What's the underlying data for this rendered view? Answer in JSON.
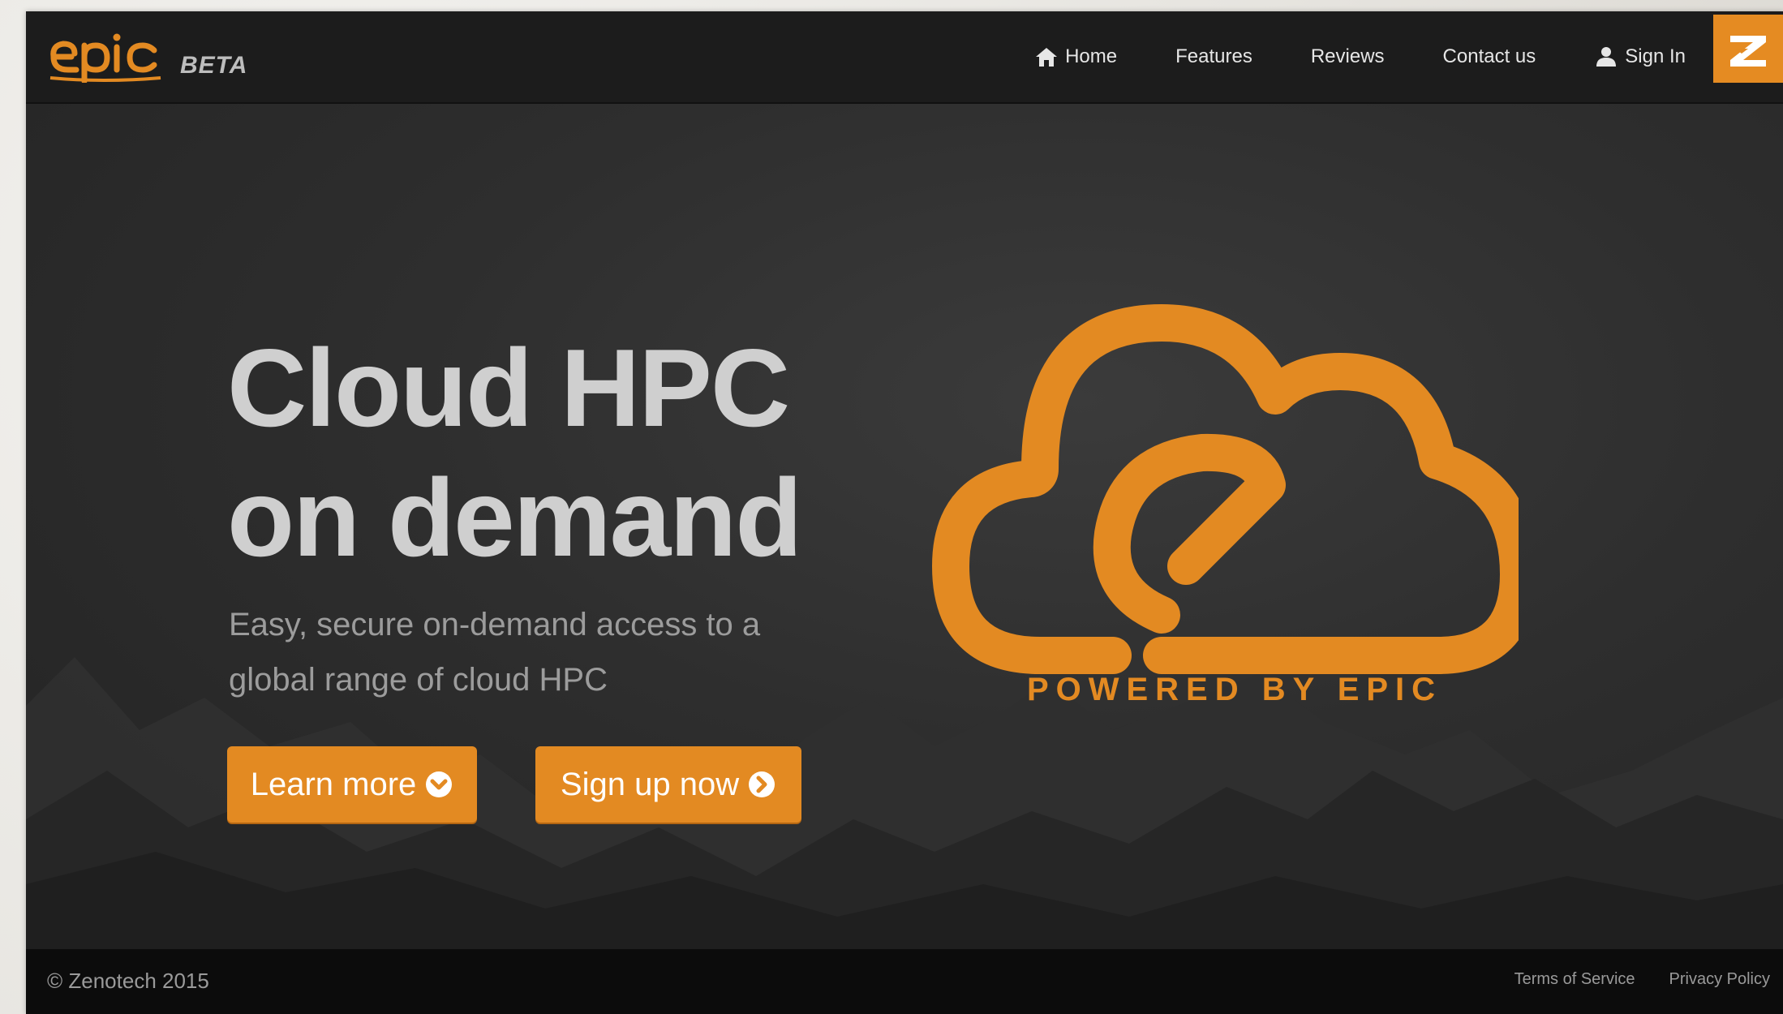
{
  "brand": {
    "logo_text": "epic",
    "beta_label": "BETA",
    "accent_color": "#e38a22"
  },
  "nav": {
    "items": [
      {
        "label": "Home",
        "icon": "home-icon"
      },
      {
        "label": "Features"
      },
      {
        "label": "Reviews"
      },
      {
        "label": "Contact us"
      },
      {
        "label": "Sign In",
        "icon": "user-icon"
      }
    ],
    "corner_logo_icon": "zenotech-logo-icon"
  },
  "hero": {
    "title_line1": "Cloud HPC",
    "title_line2": "on demand",
    "subtitle_line1": "Easy, secure on-demand access to a",
    "subtitle_line2": "global range of cloud HPC",
    "learn_more_label": "Learn more",
    "learn_more_icon": "chevron-circle-down-icon",
    "signup_label": "Sign up now",
    "signup_icon": "chevron-circle-right-icon",
    "powered_by": "POWERED BY EPIC"
  },
  "footer": {
    "copyright": "© Zenotech 2015",
    "links": [
      "Terms of Service",
      "Privacy Policy"
    ]
  }
}
